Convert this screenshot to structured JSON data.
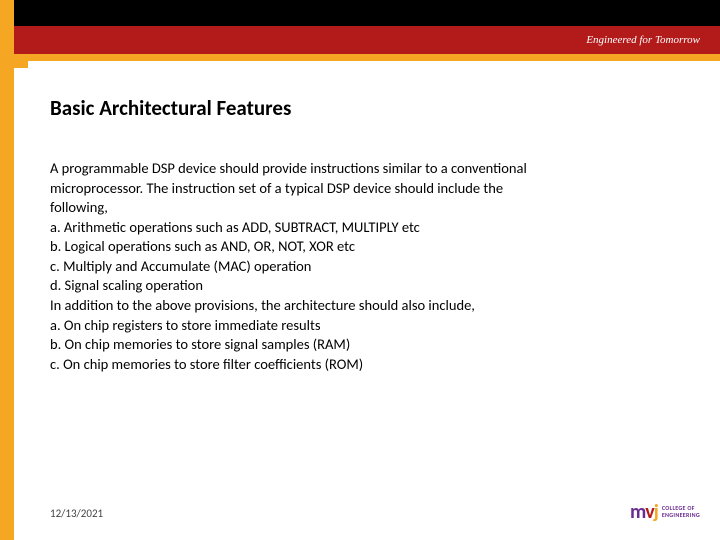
{
  "header": {
    "tagline": "Engineered for Tomorrow"
  },
  "slide": {
    "title": "Basic Architectural Features",
    "lines": [
      "A programmable DSP device should provide instructions similar to a conventional",
      "microprocessor. The instruction set of a typical DSP device should include the",
      "following,",
      "a. Arithmetic operations such as ADD, SUBTRACT, MULTIPLY etc",
      "b. Logical operations such as AND, OR, NOT, XOR etc",
      "c. Multiply and Accumulate (MAC) operation",
      "d. Signal scaling operation",
      "In addition to the above provisions, the architecture should also include,",
      "a. On chip registers to store immediate results",
      "b. On chip memories to store signal samples (RAM)",
      "c. On chip memories to store filter coefficients (ROM)"
    ]
  },
  "footer": {
    "date": "12/13/2021",
    "logo": {
      "m": "m",
      "v": "v",
      "j": "j",
      "line1": "COLLEGE OF",
      "line2": "ENGINEERING"
    }
  }
}
